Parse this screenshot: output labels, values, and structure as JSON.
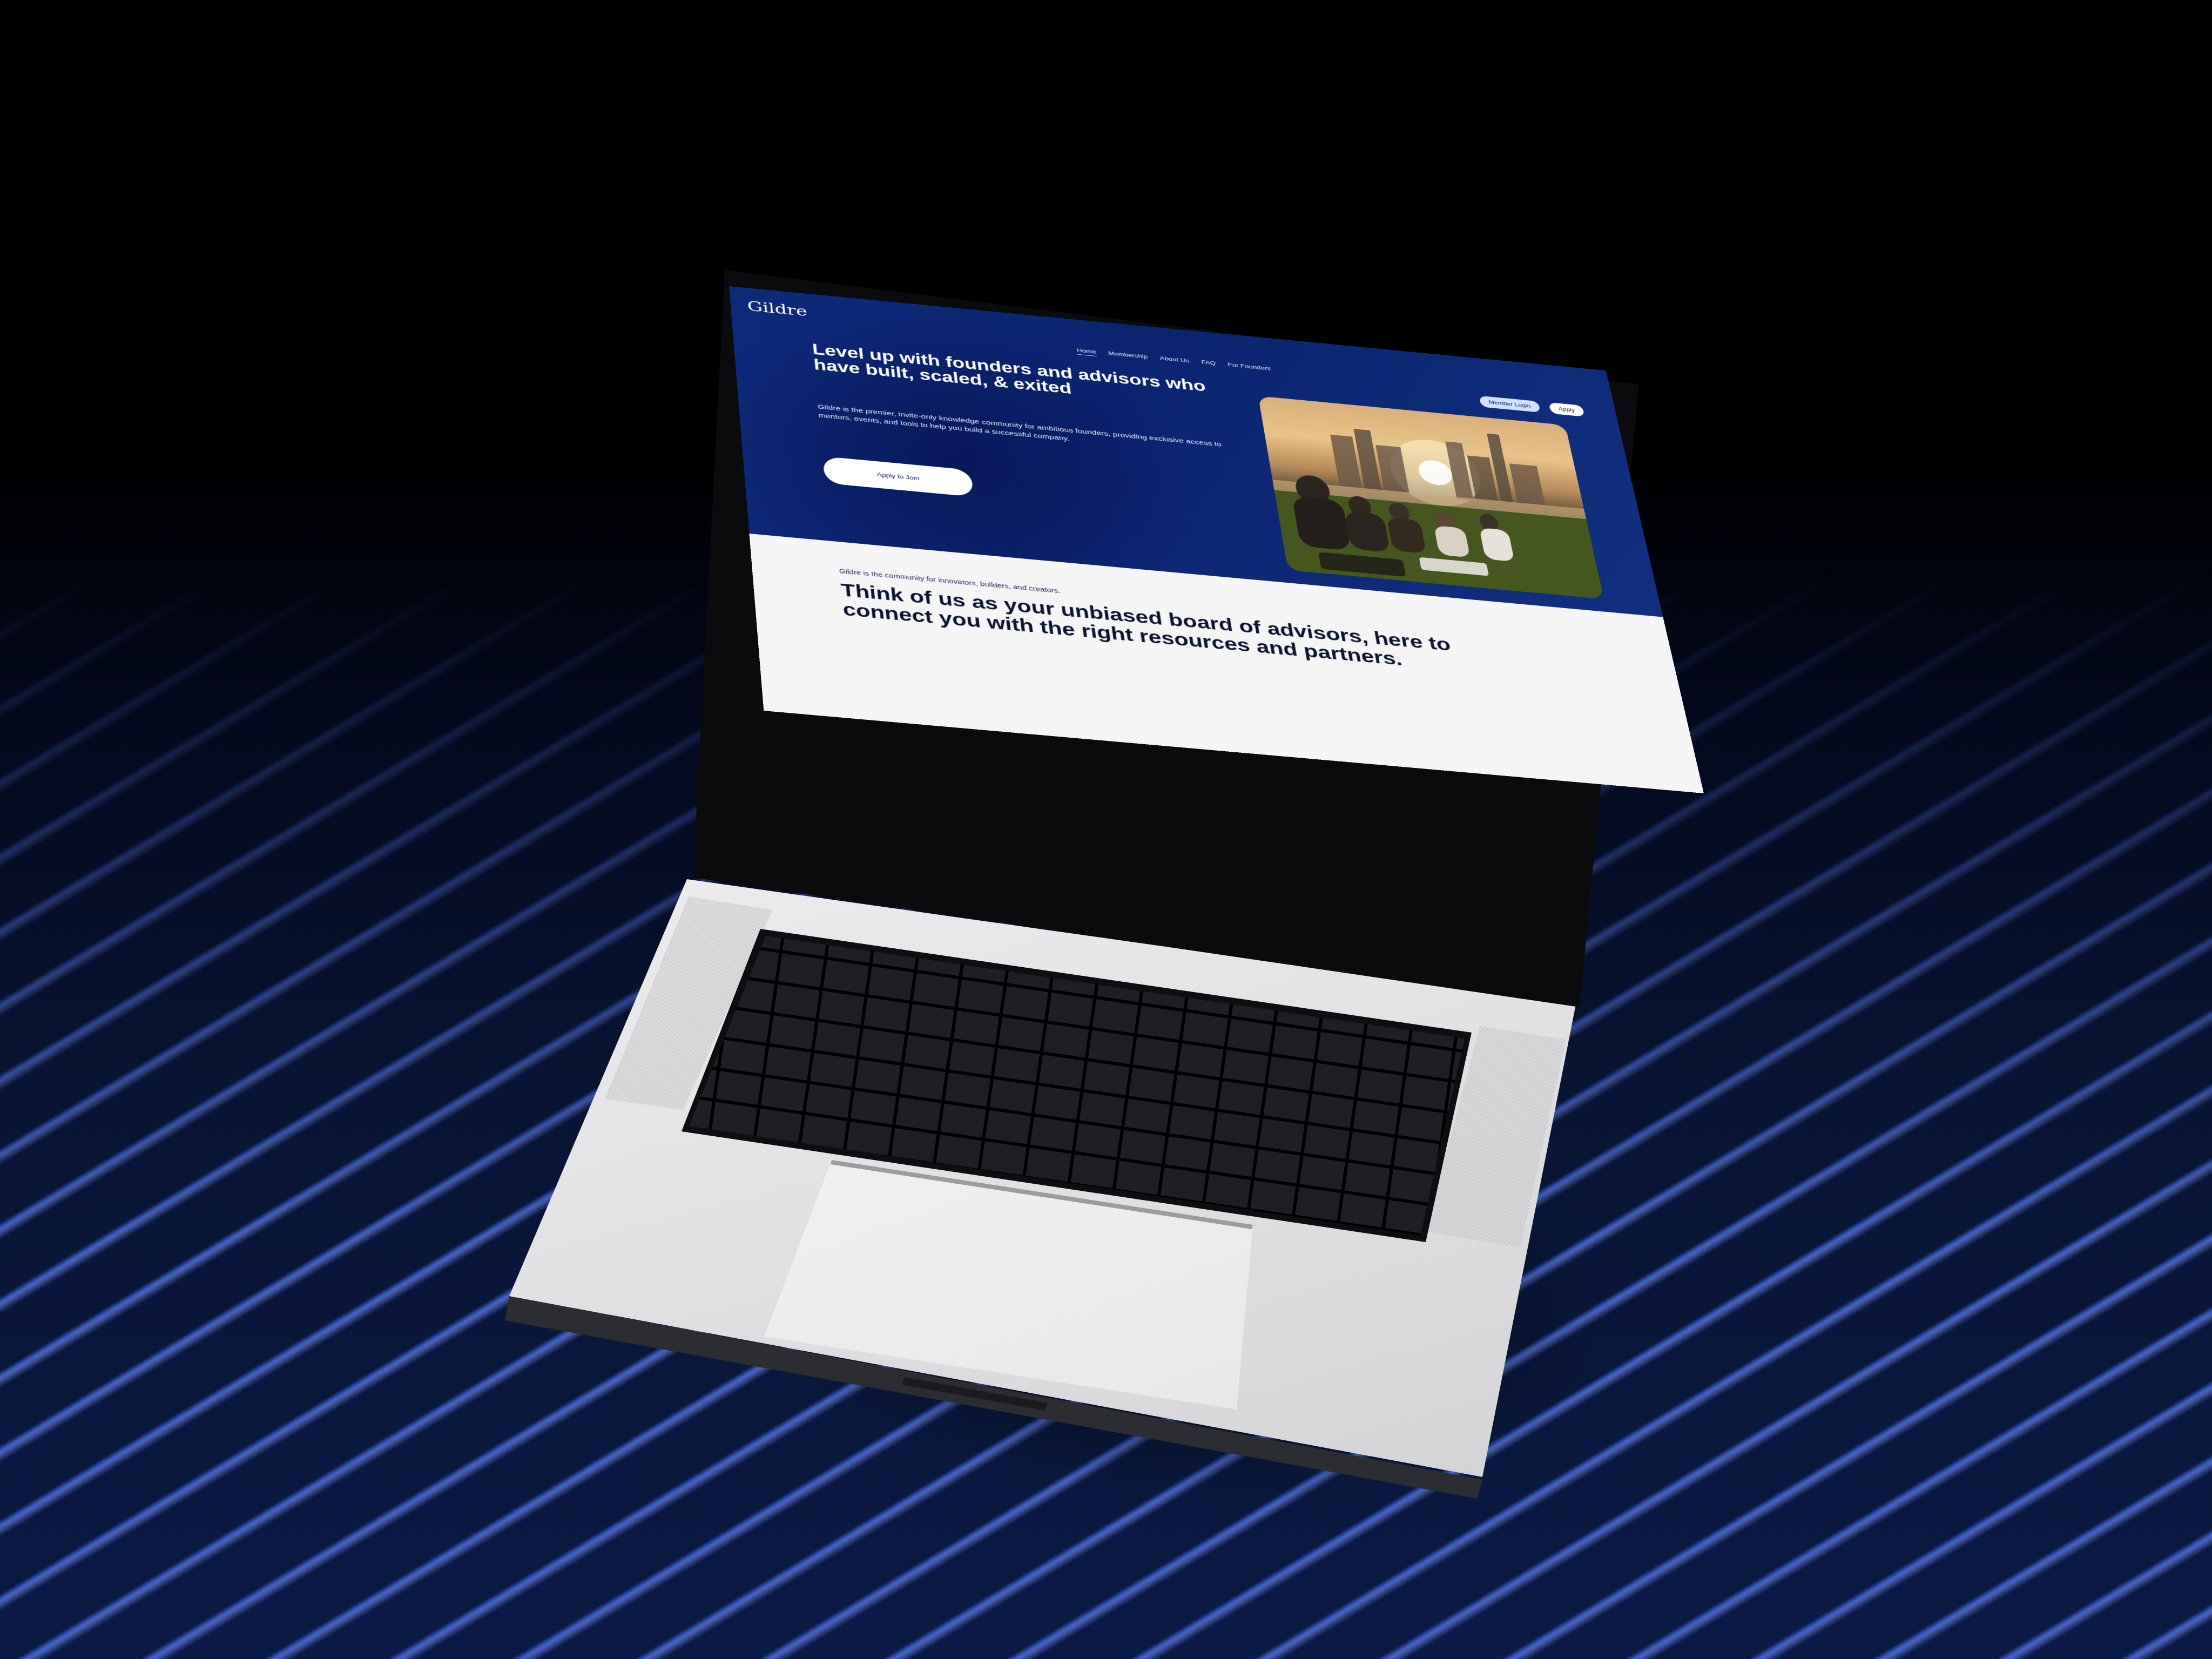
{
  "site": {
    "brand": "Gildre",
    "nav": [
      {
        "label": "Home",
        "active": true
      },
      {
        "label": "Membership",
        "active": false
      },
      {
        "label": "About Us",
        "active": false
      },
      {
        "label": "FAQ",
        "active": false
      },
      {
        "label": "For Founders",
        "active": false
      }
    ],
    "header_buttons": {
      "member_login": "Member Login",
      "apply": "Apply"
    },
    "hero": {
      "title": "Level up with founders and advisors who have built, scaled, & exited",
      "subtitle": "Gildre is the premier, invite-only knowledge community for ambitious founders, providing exclusive access to mentors, events, and tools to help you build a successful company.",
      "cta": "Apply to Join",
      "image_icon": "photo-group-on-lawn-city-skyline"
    },
    "section": {
      "kicker": "Gildre is the community for innovators, builders, and creators.",
      "heading": "Think of us as your unbiased board of advisors, here to connect you with the right resources and partners."
    },
    "colors": {
      "hero_blue": "#0d2a7a",
      "button_light": "#cfe1ff",
      "section_bg": "#f5f5f6"
    }
  }
}
